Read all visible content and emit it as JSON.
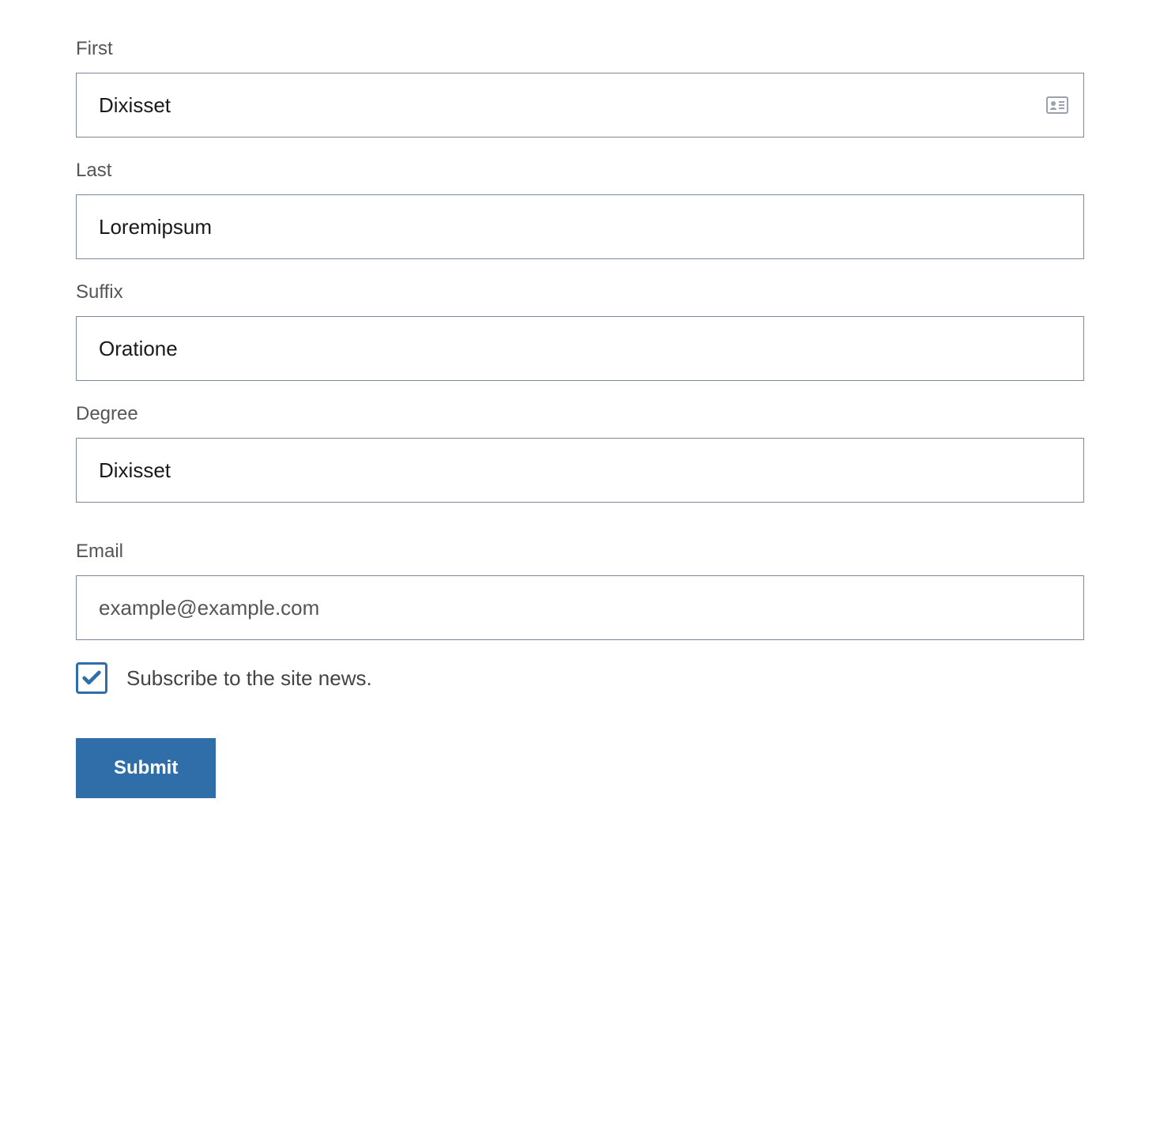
{
  "form": {
    "first": {
      "label": "First",
      "value": "Dixisset"
    },
    "last": {
      "label": "Last",
      "value": "Loremipsum"
    },
    "suffix": {
      "label": "Suffix",
      "value": "Oratione"
    },
    "degree": {
      "label": "Degree",
      "value": "Dixisset"
    },
    "email": {
      "label": "Email",
      "placeholder": "example@example.com",
      "value": ""
    },
    "subscribe": {
      "label": "Subscribe to the site news.",
      "checked": true
    },
    "submit": {
      "label": "Submit"
    }
  }
}
